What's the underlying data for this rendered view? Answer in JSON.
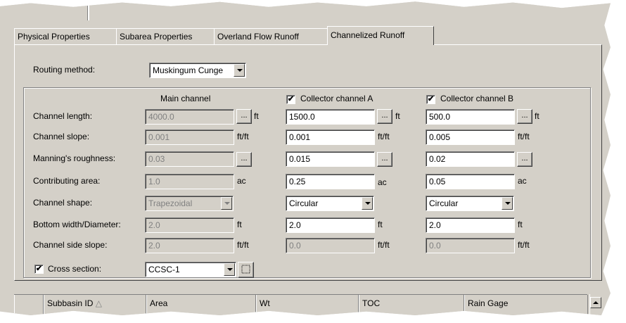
{
  "tabs": [
    {
      "label": "Physical Properties"
    },
    {
      "label": "Subarea Properties"
    },
    {
      "label": "Overland Flow Runoff"
    },
    {
      "label": "Channelized Runoff"
    }
  ],
  "routing": {
    "label": "Routing method:",
    "value": "Muskingum Cunge"
  },
  "columns": {
    "main": {
      "header": "Main channel"
    },
    "a": {
      "header": "Collector channel A",
      "checked": true
    },
    "b": {
      "header": "Collector channel B",
      "checked": true
    }
  },
  "rows": {
    "length": {
      "label": "Channel length:",
      "main": "4000.0",
      "a": "1500.0",
      "b": "500.0",
      "unit": "ft"
    },
    "slope": {
      "label": "Channel slope:",
      "main": "0.001",
      "a": "0.001",
      "b": "0.005",
      "unit": "ft/ft"
    },
    "manning": {
      "label": "Manning's roughness:",
      "main": "0.03",
      "a": "0.015",
      "b": "0.02",
      "unit": ""
    },
    "area": {
      "label": "Contributing area:",
      "main": "1.0",
      "a": "0.25",
      "b": "0.05",
      "unit": "ac"
    },
    "shape": {
      "label": "Channel shape:",
      "main": "Trapezoidal",
      "a": "Circular",
      "b": "Circular"
    },
    "width": {
      "label": "Bottom width/Diameter:",
      "main": "2.0",
      "a": "2.0",
      "b": "2.0",
      "unit": "ft"
    },
    "side": {
      "label": "Channel side slope:",
      "main": "2.0",
      "a": "0.0",
      "b": "0.0",
      "unit": "ft/ft"
    }
  },
  "browse_label": "...",
  "cross_section": {
    "label": "Cross section:",
    "value": "CCSC-1",
    "checked": true
  },
  "grid": {
    "columns": [
      "Subbasin ID",
      "Area",
      "Wt",
      "TOC",
      "Rain Gage"
    ]
  },
  "check_mark": "✔",
  "sort_glyph": "△"
}
